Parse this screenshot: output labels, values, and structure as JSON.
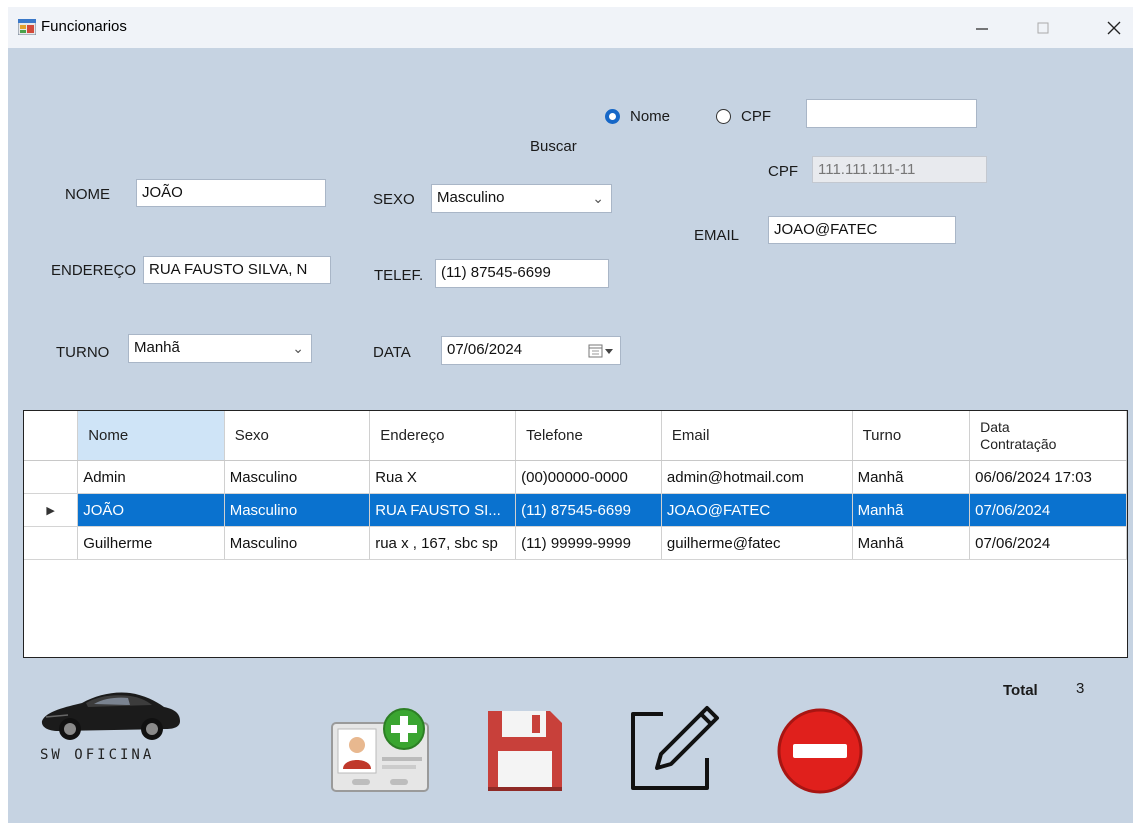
{
  "window": {
    "title": "Funcionarios"
  },
  "search": {
    "label": "Buscar",
    "option_nome": "Nome",
    "option_cpf": "CPF",
    "selected": "Nome",
    "value": ""
  },
  "form": {
    "nome_label": "NOME",
    "nome_value": "JOÃO",
    "endereco_label": "ENDEREÇO",
    "endereco_value": "RUA FAUSTO SILVA, N",
    "turno_label": "TURNO",
    "turno_value": "Manhã",
    "sexo_label": "SEXO",
    "sexo_value": "Masculino",
    "telef_label": "TELEF.",
    "telef_value": "(11) 87545-6699",
    "data_label": "DATA",
    "data_value": "07/06/2024",
    "cpf_label": "CPF",
    "cpf_value": "111.111.111-11",
    "email_label": "EMAIL",
    "email_value": "JOAO@FATEC"
  },
  "grid": {
    "columns": [
      "Nome",
      "Sexo",
      "Endereço",
      "Telefone",
      "Email",
      "Turno",
      "Data Contratação"
    ],
    "rows": [
      [
        "Admin",
        "Masculino",
        "Rua X",
        "(00)00000-0000",
        "admin@hotmail.com",
        "Manhã",
        "06/06/2024 17:03"
      ],
      [
        "JOÃO",
        "Masculino",
        "RUA FAUSTO SI...",
        "(11) 87545-6699",
        "JOAO@FATEC",
        "Manhã",
        "07/06/2024"
      ],
      [
        "Guilherme",
        "Masculino",
        "rua x , 167, sbc sp",
        "(11) 99999-9999",
        "guilherme@fatec",
        "Manhã",
        "07/06/2024"
      ]
    ],
    "selected_row": 1
  },
  "total": {
    "label": "Total",
    "value": "3"
  },
  "logo": {
    "text": "SW OFICINA"
  },
  "icons": [
    "add-employee-icon",
    "save-icon",
    "edit-icon",
    "delete-icon",
    "car-logo-icon",
    "calendar-icon"
  ]
}
